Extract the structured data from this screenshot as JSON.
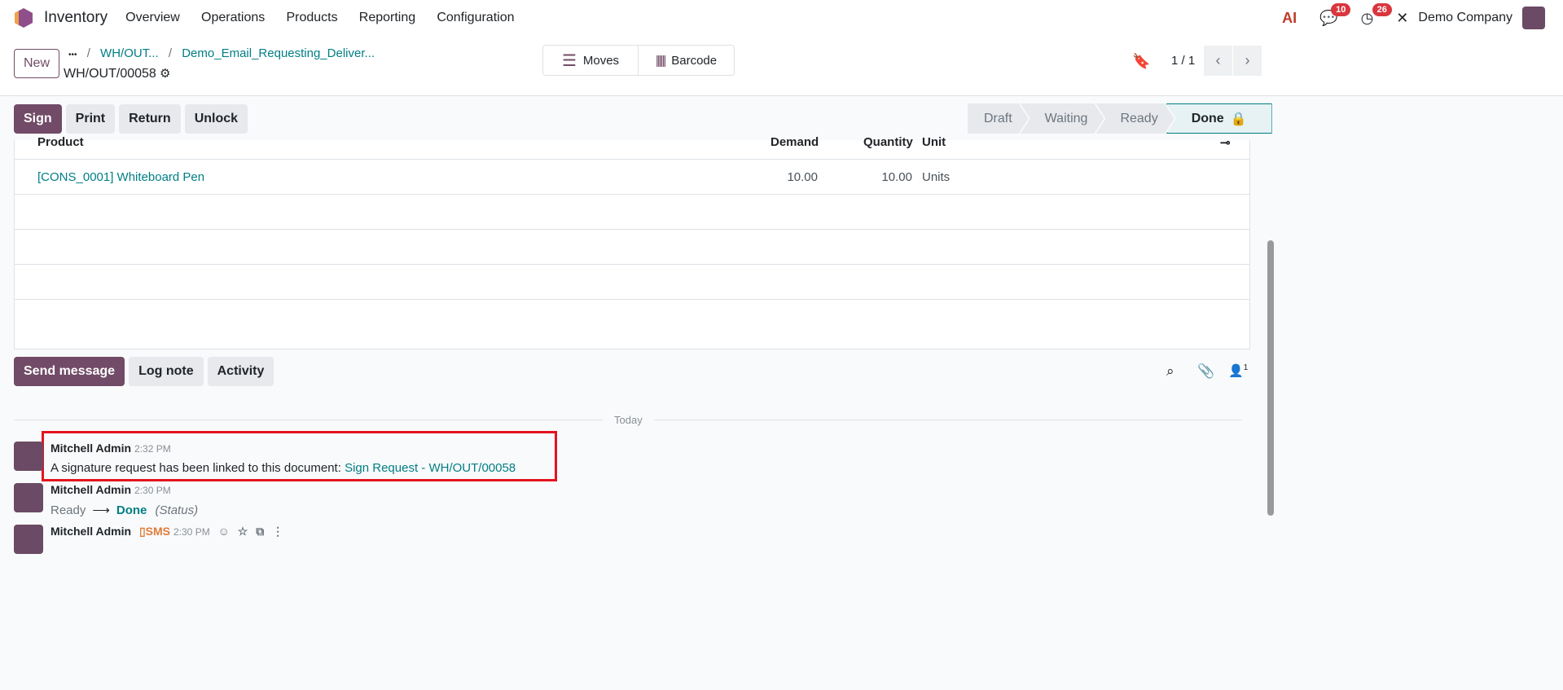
{
  "nav": {
    "app": "Inventory",
    "menu": [
      "Overview",
      "Operations",
      "Products",
      "Reporting",
      "Configuration"
    ],
    "messages_count": "10",
    "activities_count": "26",
    "company": "Demo Company"
  },
  "control": {
    "new_label": "New",
    "breadcrumb": [
      "•••",
      "WH/OUT...",
      "Demo_Email_Requesting_Deliver..."
    ],
    "record": "WH/OUT/00058",
    "moves_label": "Moves",
    "barcode_label": "Barcode",
    "pager": "1 / 1"
  },
  "actions": [
    "Sign",
    "Print",
    "Return",
    "Unlock"
  ],
  "status": {
    "steps": [
      "Draft",
      "Waiting",
      "Ready",
      "Done"
    ],
    "current": "Done"
  },
  "table": {
    "headers": [
      "Product",
      "Demand",
      "Quantity",
      "Unit"
    ],
    "rows": [
      {
        "product": "[CONS_0001] Whiteboard Pen",
        "demand": "10.00",
        "quantity": "10.00",
        "unit": "Units"
      }
    ]
  },
  "chatter": {
    "buttons": [
      "Send message",
      "Log note",
      "Activity"
    ],
    "followers": "1",
    "date_sep": "Today",
    "messages": [
      {
        "author": "Mitchell Admin",
        "time": "2:32 PM",
        "text": "A signature request has been linked to this document: ",
        "link": "Sign Request - WH/OUT/00058"
      },
      {
        "author": "Mitchell Admin",
        "time": "2:30 PM",
        "from": "Ready",
        "to": "Done",
        "field": "(Status)"
      },
      {
        "author": "Mitchell Admin",
        "sms": "SMS",
        "time": "2:30 PM"
      }
    ]
  },
  "colors": {
    "brand": "#714b67",
    "link": "#017e84",
    "highlight": "#e3141f"
  }
}
